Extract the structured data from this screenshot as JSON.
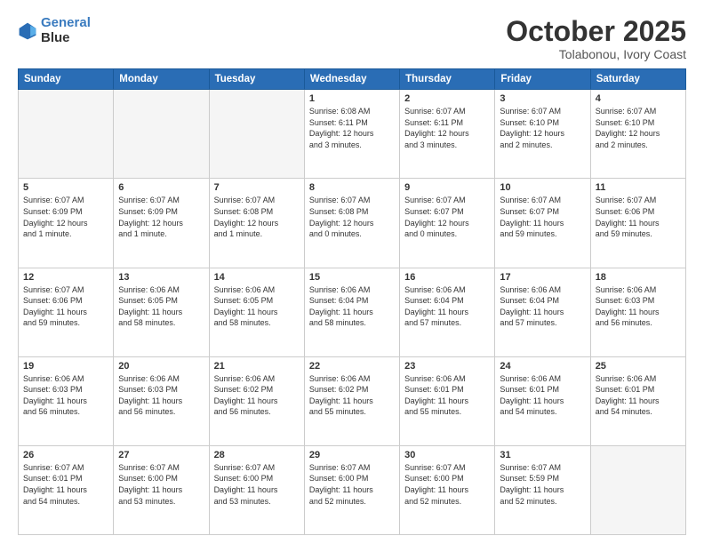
{
  "header": {
    "logo_line1": "General",
    "logo_line2": "Blue",
    "title": "October 2025",
    "subtitle": "Tolabonou, Ivory Coast"
  },
  "weekdays": [
    "Sunday",
    "Monday",
    "Tuesday",
    "Wednesday",
    "Thursday",
    "Friday",
    "Saturday"
  ],
  "weeks": [
    [
      {
        "day": "",
        "info": ""
      },
      {
        "day": "",
        "info": ""
      },
      {
        "day": "",
        "info": ""
      },
      {
        "day": "1",
        "info": "Sunrise: 6:08 AM\nSunset: 6:11 PM\nDaylight: 12 hours\nand 3 minutes."
      },
      {
        "day": "2",
        "info": "Sunrise: 6:07 AM\nSunset: 6:11 PM\nDaylight: 12 hours\nand 3 minutes."
      },
      {
        "day": "3",
        "info": "Sunrise: 6:07 AM\nSunset: 6:10 PM\nDaylight: 12 hours\nand 2 minutes."
      },
      {
        "day": "4",
        "info": "Sunrise: 6:07 AM\nSunset: 6:10 PM\nDaylight: 12 hours\nand 2 minutes."
      }
    ],
    [
      {
        "day": "5",
        "info": "Sunrise: 6:07 AM\nSunset: 6:09 PM\nDaylight: 12 hours\nand 1 minute."
      },
      {
        "day": "6",
        "info": "Sunrise: 6:07 AM\nSunset: 6:09 PM\nDaylight: 12 hours\nand 1 minute."
      },
      {
        "day": "7",
        "info": "Sunrise: 6:07 AM\nSunset: 6:08 PM\nDaylight: 12 hours\nand 1 minute."
      },
      {
        "day": "8",
        "info": "Sunrise: 6:07 AM\nSunset: 6:08 PM\nDaylight: 12 hours\nand 0 minutes."
      },
      {
        "day": "9",
        "info": "Sunrise: 6:07 AM\nSunset: 6:07 PM\nDaylight: 12 hours\nand 0 minutes."
      },
      {
        "day": "10",
        "info": "Sunrise: 6:07 AM\nSunset: 6:07 PM\nDaylight: 11 hours\nand 59 minutes."
      },
      {
        "day": "11",
        "info": "Sunrise: 6:07 AM\nSunset: 6:06 PM\nDaylight: 11 hours\nand 59 minutes."
      }
    ],
    [
      {
        "day": "12",
        "info": "Sunrise: 6:07 AM\nSunset: 6:06 PM\nDaylight: 11 hours\nand 59 minutes."
      },
      {
        "day": "13",
        "info": "Sunrise: 6:06 AM\nSunset: 6:05 PM\nDaylight: 11 hours\nand 58 minutes."
      },
      {
        "day": "14",
        "info": "Sunrise: 6:06 AM\nSunset: 6:05 PM\nDaylight: 11 hours\nand 58 minutes."
      },
      {
        "day": "15",
        "info": "Sunrise: 6:06 AM\nSunset: 6:04 PM\nDaylight: 11 hours\nand 58 minutes."
      },
      {
        "day": "16",
        "info": "Sunrise: 6:06 AM\nSunset: 6:04 PM\nDaylight: 11 hours\nand 57 minutes."
      },
      {
        "day": "17",
        "info": "Sunrise: 6:06 AM\nSunset: 6:04 PM\nDaylight: 11 hours\nand 57 minutes."
      },
      {
        "day": "18",
        "info": "Sunrise: 6:06 AM\nSunset: 6:03 PM\nDaylight: 11 hours\nand 56 minutes."
      }
    ],
    [
      {
        "day": "19",
        "info": "Sunrise: 6:06 AM\nSunset: 6:03 PM\nDaylight: 11 hours\nand 56 minutes."
      },
      {
        "day": "20",
        "info": "Sunrise: 6:06 AM\nSunset: 6:03 PM\nDaylight: 11 hours\nand 56 minutes."
      },
      {
        "day": "21",
        "info": "Sunrise: 6:06 AM\nSunset: 6:02 PM\nDaylight: 11 hours\nand 56 minutes."
      },
      {
        "day": "22",
        "info": "Sunrise: 6:06 AM\nSunset: 6:02 PM\nDaylight: 11 hours\nand 55 minutes."
      },
      {
        "day": "23",
        "info": "Sunrise: 6:06 AM\nSunset: 6:01 PM\nDaylight: 11 hours\nand 55 minutes."
      },
      {
        "day": "24",
        "info": "Sunrise: 6:06 AM\nSunset: 6:01 PM\nDaylight: 11 hours\nand 54 minutes."
      },
      {
        "day": "25",
        "info": "Sunrise: 6:06 AM\nSunset: 6:01 PM\nDaylight: 11 hours\nand 54 minutes."
      }
    ],
    [
      {
        "day": "26",
        "info": "Sunrise: 6:07 AM\nSunset: 6:01 PM\nDaylight: 11 hours\nand 54 minutes."
      },
      {
        "day": "27",
        "info": "Sunrise: 6:07 AM\nSunset: 6:00 PM\nDaylight: 11 hours\nand 53 minutes."
      },
      {
        "day": "28",
        "info": "Sunrise: 6:07 AM\nSunset: 6:00 PM\nDaylight: 11 hours\nand 53 minutes."
      },
      {
        "day": "29",
        "info": "Sunrise: 6:07 AM\nSunset: 6:00 PM\nDaylight: 11 hours\nand 52 minutes."
      },
      {
        "day": "30",
        "info": "Sunrise: 6:07 AM\nSunset: 6:00 PM\nDaylight: 11 hours\nand 52 minutes."
      },
      {
        "day": "31",
        "info": "Sunrise: 6:07 AM\nSunset: 5:59 PM\nDaylight: 11 hours\nand 52 minutes."
      },
      {
        "day": "",
        "info": ""
      }
    ]
  ]
}
